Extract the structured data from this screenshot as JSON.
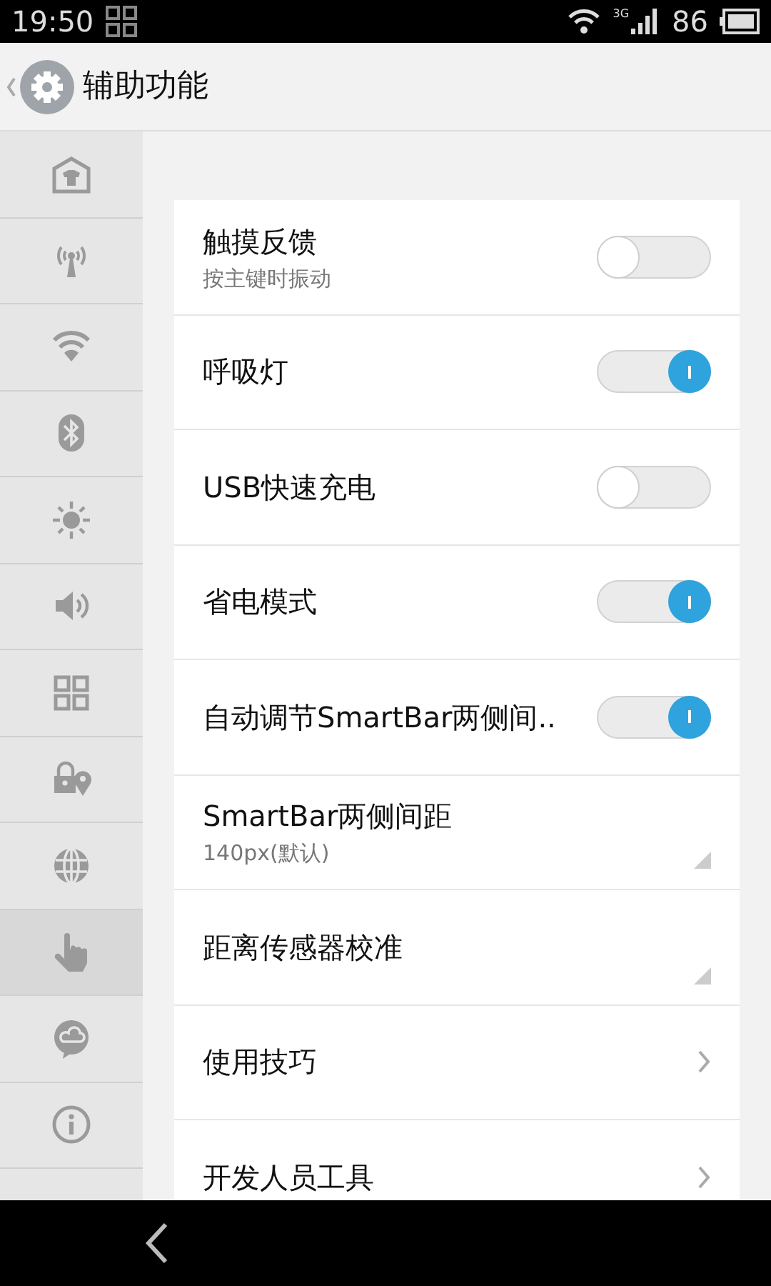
{
  "status_bar": {
    "time": "19:50",
    "network": "3G",
    "battery": "86"
  },
  "header": {
    "title": "辅助功能"
  },
  "sidebar": {
    "items": [
      {
        "selected": false
      },
      {
        "selected": false
      },
      {
        "selected": false
      },
      {
        "selected": false
      },
      {
        "selected": false
      },
      {
        "selected": false
      },
      {
        "selected": false
      },
      {
        "selected": false
      },
      {
        "selected": false
      },
      {
        "selected": true
      },
      {
        "selected": false
      },
      {
        "selected": false
      }
    ]
  },
  "settings": [
    {
      "kind": "toggle",
      "title": "触摸反馈",
      "subtitle": "按主键时振动",
      "on": false
    },
    {
      "kind": "toggle",
      "title": "呼吸灯",
      "on": true
    },
    {
      "kind": "toggle",
      "title": "USB快速充电",
      "on": false
    },
    {
      "kind": "toggle",
      "title": "省电模式",
      "on": true
    },
    {
      "kind": "toggle",
      "title": "自动调节SmartBar两侧间..",
      "on": true
    },
    {
      "kind": "select",
      "title": "SmartBar两侧间距",
      "subtitle": "140px(默认)"
    },
    {
      "kind": "select",
      "title": "距离传感器校准"
    },
    {
      "kind": "link",
      "title": "使用技巧"
    },
    {
      "kind": "link",
      "title": "开发人员工具"
    }
  ]
}
